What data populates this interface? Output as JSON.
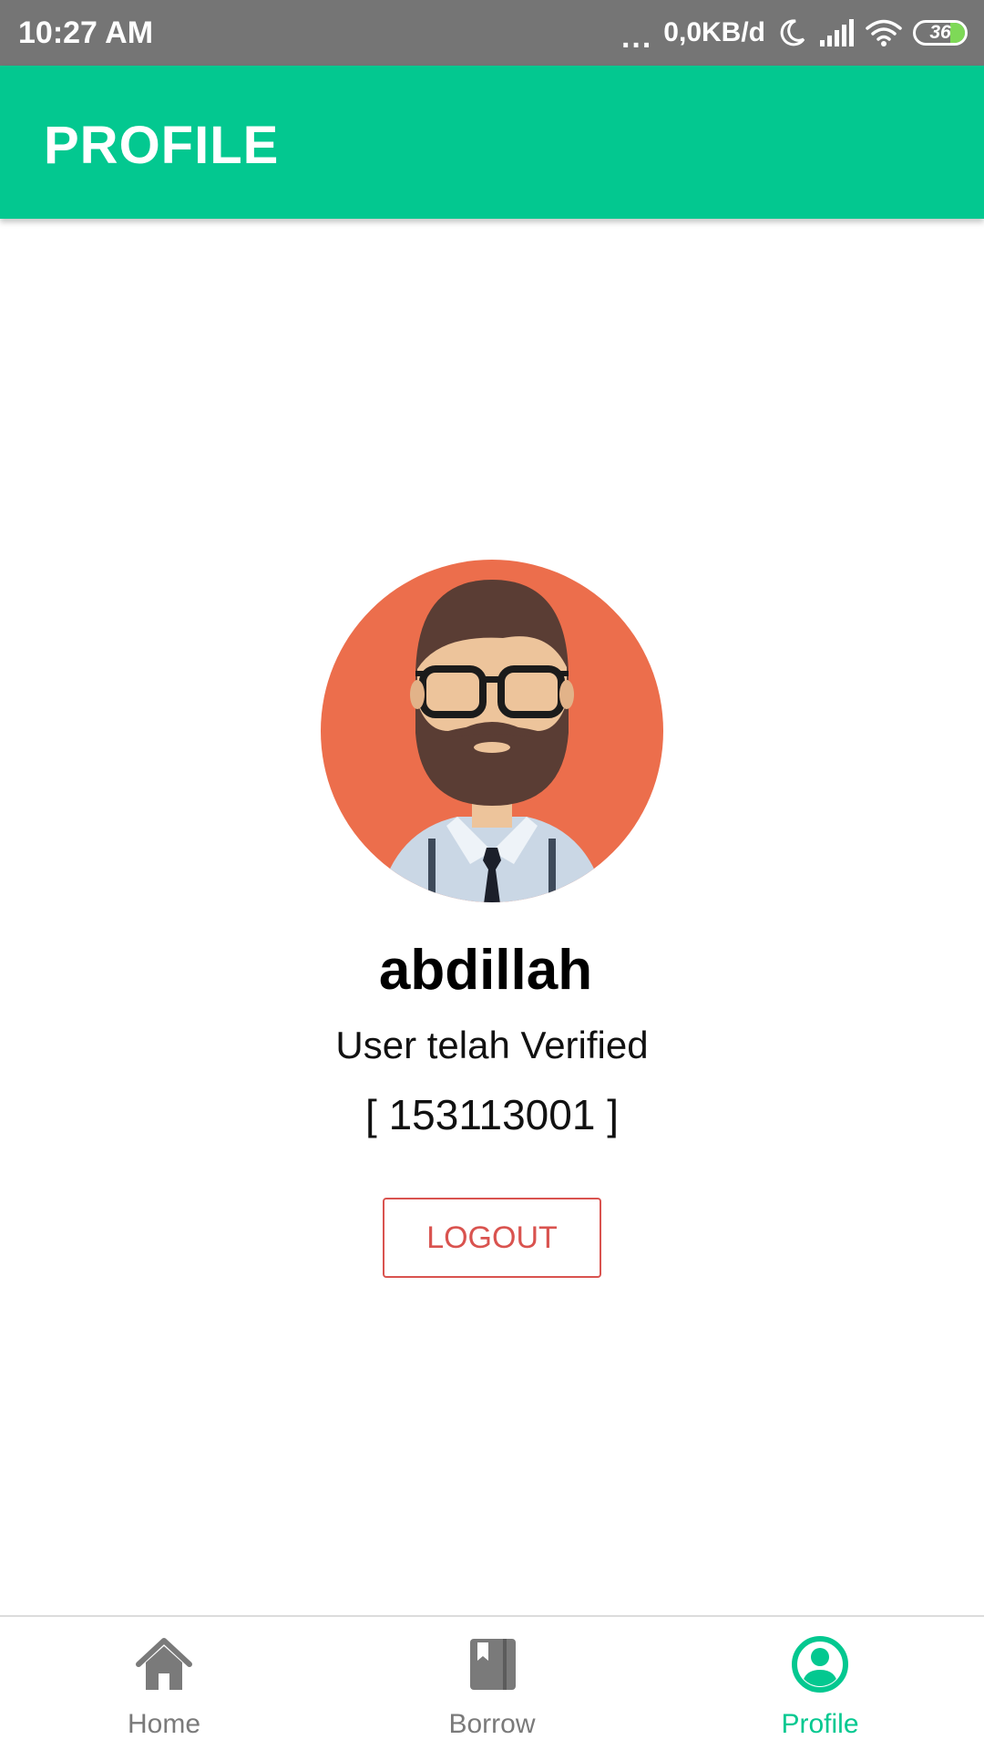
{
  "status_bar": {
    "time": "10:27 AM",
    "dots": "...",
    "speed": "0,0KB/d",
    "battery_level": "36",
    "icons": [
      "moon-icon",
      "signal-icon",
      "wifi-icon",
      "battery-icon"
    ]
  },
  "app_bar": {
    "title": "PROFILE"
  },
  "profile": {
    "avatar_icon": "bearded-man-avatar",
    "name": "abdillah",
    "status": "User telah Verified",
    "id": "[ 153113001 ]",
    "logout_label": "LOGOUT"
  },
  "bottom_nav": {
    "items": [
      {
        "label": "Home",
        "icon": "home-icon",
        "active": false
      },
      {
        "label": "Borrow",
        "icon": "book-icon",
        "active": false
      },
      {
        "label": "Profile",
        "icon": "profile-icon",
        "active": true
      }
    ]
  },
  "colors": {
    "status_bar": "#757575",
    "primary": "#03c890",
    "logout": "#d9534f",
    "avatar_bg": "#ec6e4c",
    "inactive_nav": "#7a7a7a"
  }
}
